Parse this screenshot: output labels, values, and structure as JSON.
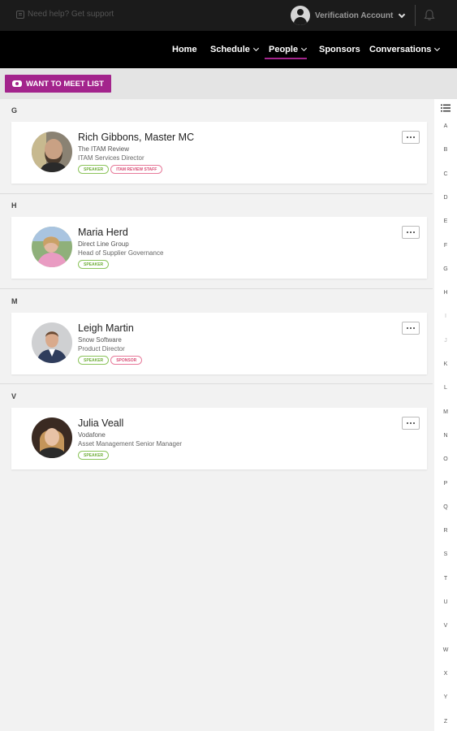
{
  "topbar": {
    "help_text": "Need help? Get support",
    "account_name": "Verification Account"
  },
  "nav": {
    "items": [
      {
        "label": "Home",
        "has_dropdown": false
      },
      {
        "label": "Schedule",
        "has_dropdown": true
      },
      {
        "label": "People",
        "has_dropdown": true,
        "active": true
      },
      {
        "label": "Sponsors",
        "has_dropdown": false
      },
      {
        "label": "Conversations",
        "has_dropdown": true
      }
    ],
    "active_color": "#a3248c"
  },
  "toolbar": {
    "meet_list_label": "WANT TO MEET LIST"
  },
  "sections": [
    {
      "letter": "G",
      "people": [
        {
          "name": "Rich Gibbons, Master MC",
          "company": "The ITAM Review",
          "title": "ITAM Services Director",
          "tags": [
            "SPEAKER",
            "ITAM REVIEW STAFF"
          ]
        }
      ]
    },
    {
      "letter": "H",
      "people": [
        {
          "name": "Maria Herd",
          "company": "Direct Line Group",
          "title": "Head of Supplier Governance",
          "tags": [
            "SPEAKER"
          ]
        }
      ]
    },
    {
      "letter": "M",
      "people": [
        {
          "name": "Leigh Martin",
          "company": "Snow Software",
          "title": "Product Director",
          "tags": [
            "SPEAKER",
            "SPONSOR"
          ]
        }
      ]
    },
    {
      "letter": "V",
      "people": [
        {
          "name": "Julia Veall",
          "company": "Vodafone",
          "title": "Asset Management Senior Manager",
          "tags": [
            "SPEAKER"
          ]
        }
      ]
    }
  ],
  "alphabet": [
    "A",
    "B",
    "C",
    "D",
    "E",
    "F",
    "G",
    "H",
    "I",
    "J",
    "K",
    "L",
    "M",
    "N",
    "O",
    "P",
    "Q",
    "R",
    "S",
    "T",
    "U",
    "V",
    "W",
    "X",
    "Y",
    "Z"
  ],
  "colors": {
    "brand": "#a3248c",
    "speaker_tag": "#6fae3a",
    "staff_tag": "#d94c75"
  }
}
